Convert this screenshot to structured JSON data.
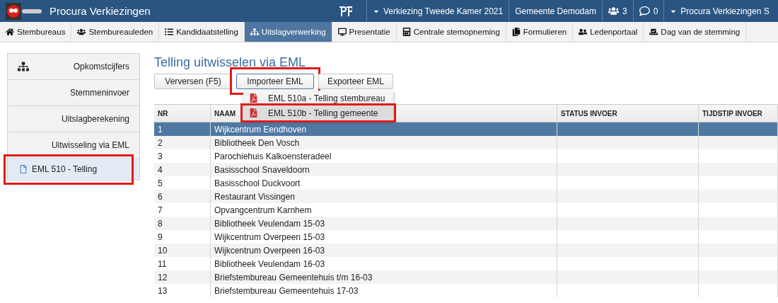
{
  "header": {
    "title": "Procura Verkiezingen",
    "items": [
      {
        "kind": "dropdown",
        "label": "Verkiezing Tweede Kamer 2021"
      },
      {
        "kind": "text",
        "label": "Gemeente Demodam"
      },
      {
        "kind": "users",
        "label": "3"
      },
      {
        "kind": "messages",
        "label": "0"
      },
      {
        "kind": "dropdown",
        "label": "Procura Verkiezingen S"
      }
    ]
  },
  "menu": [
    {
      "label": "Stembureaus",
      "selected": false
    },
    {
      "label": "Stembureauleden",
      "selected": false
    },
    {
      "label": "Kandidaatstelling",
      "selected": false
    },
    {
      "label": "Uitslagverwerking",
      "selected": true
    },
    {
      "label": "Presentatie",
      "selected": false
    },
    {
      "label": "Centrale stemopneming",
      "selected": false
    },
    {
      "label": "Formulieren",
      "selected": false
    },
    {
      "label": "Ledenportaal",
      "selected": false
    },
    {
      "label": "Dag van de stemming",
      "selected": false
    }
  ],
  "sidebar": {
    "items": [
      {
        "label": "Opkomstcijfers"
      },
      {
        "label": "Stemmeninvoer"
      },
      {
        "label": "Uitslagberekening"
      },
      {
        "label": "Uitwisseling via EML",
        "children": [
          {
            "label": "EML 510 - Telling",
            "selected": true,
            "highlighted": true
          }
        ]
      }
    ]
  },
  "page": {
    "title": "Telling uitwisselen via EML",
    "buttons": [
      {
        "label": "Verversen (F5)",
        "highlighted": false,
        "open": false
      },
      {
        "label": "Importeer EML",
        "highlighted": true,
        "open": true
      },
      {
        "label": "Exporteer EML",
        "highlighted": false,
        "open": false
      }
    ],
    "dropdown": [
      {
        "label": "EML 510a - Telling stembureau",
        "highlighted": false
      },
      {
        "label": "EML 510b - Telling gemeente",
        "highlighted": true
      }
    ]
  },
  "table": {
    "columns": [
      "NR",
      "NAAM",
      "STATUS INVOER",
      "TIJDSTIP INVOER"
    ],
    "rows": [
      {
        "nr": "1",
        "name": "Wijkcentrum Eendhoven",
        "selected": true
      },
      {
        "nr": "2",
        "name": "Bibliotheek Den Vosch",
        "selected": false
      },
      {
        "nr": "3",
        "name": "Parochiehuis Kalkoensteradeel",
        "selected": false
      },
      {
        "nr": "4",
        "name": "Basisschool Snaveldoorn",
        "selected": false
      },
      {
        "nr": "5",
        "name": "Basisschool Duckvoort",
        "selected": false
      },
      {
        "nr": "6",
        "name": "Restaurant Vissingen",
        "selected": false
      },
      {
        "nr": "7",
        "name": "Opvangcentrum Karnhem",
        "selected": false
      },
      {
        "nr": "8",
        "name": "Bibliotheek Veulendam 15-03",
        "selected": false
      },
      {
        "nr": "9",
        "name": "Wijkcentrum Overpeen 15-03",
        "selected": false
      },
      {
        "nr": "10",
        "name": "Wijkcentrum Overpeen 16-03",
        "selected": false
      },
      {
        "nr": "11",
        "name": "Bibliotheek Veulendam 16-03",
        "selected": false
      },
      {
        "nr": "12",
        "name": "Briefstembureau Gemeentehuis t/m 16-03",
        "selected": false
      },
      {
        "nr": "13",
        "name": "Briefstembureau Gemeentehuis 17-03",
        "selected": false
      }
    ]
  }
}
